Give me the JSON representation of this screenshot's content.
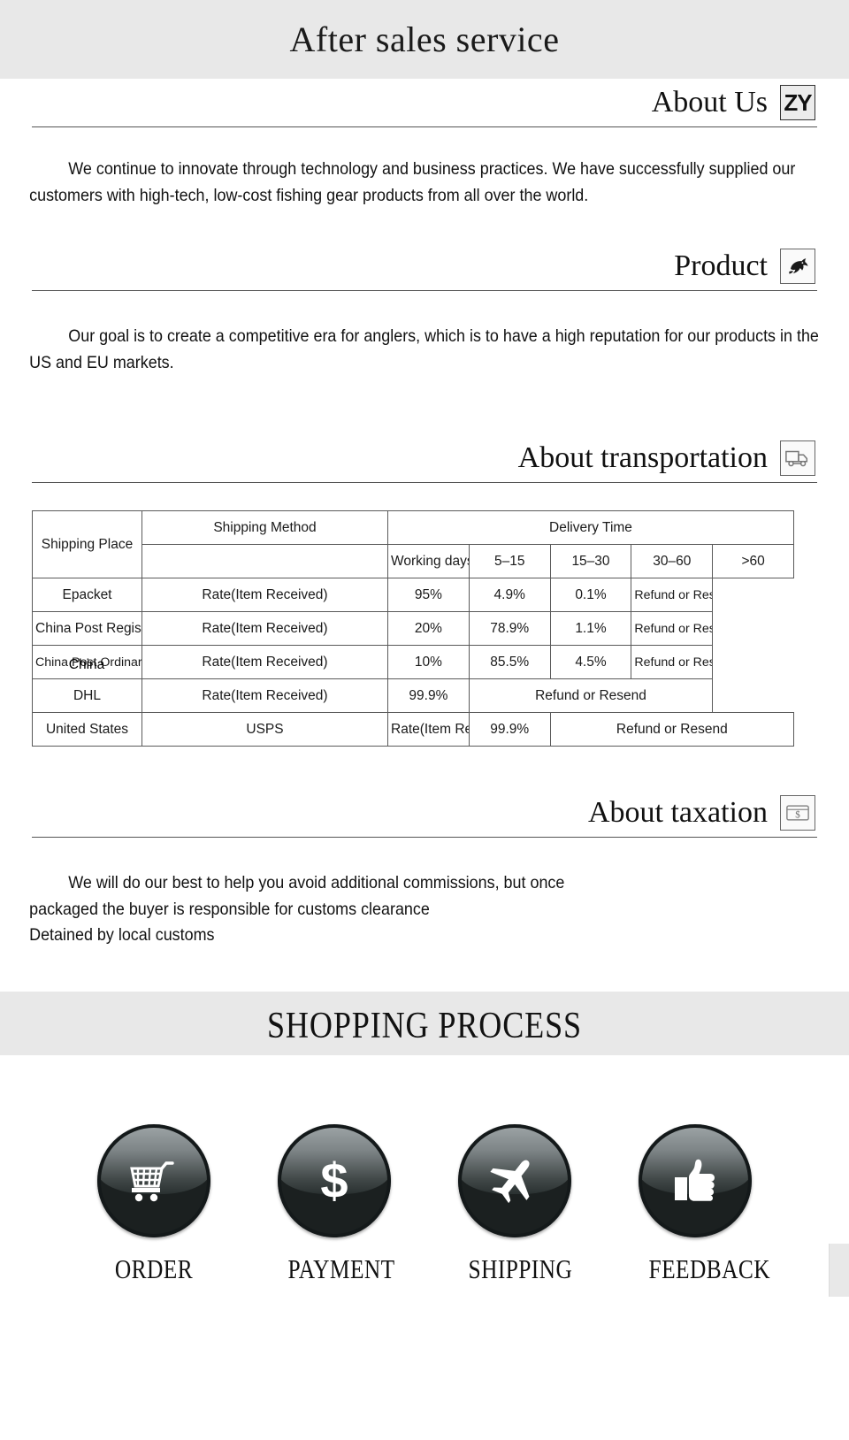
{
  "header": {
    "title": "After sales service"
  },
  "sections": [
    {
      "id": "about-us",
      "title": "About Us",
      "icon": "zy-logo-icon",
      "icon_text": "ZY",
      "paragraph": "We continue to innovate through technology and business practices. We have successfully supplied our customers with high-tech, low-cost fishing gear products from all over the world."
    },
    {
      "id": "product",
      "title": "Product",
      "icon": "fish-icon",
      "paragraph": "Our goal is to create a competitive era for anglers, which is to have a high reputation for our products in the US and EU markets."
    },
    {
      "id": "about-transportation",
      "title": "About transportation",
      "icon": "delivery-truck-icon"
    },
    {
      "id": "about-taxation",
      "title": "About taxation",
      "icon": "money-bill-icon",
      "lines": [
        "We will do our best to help you avoid additional commissions, but once",
        "packaged the buyer is responsible for customs clearance",
        "Detained by local customs"
      ]
    }
  ],
  "shipping_table": {
    "headers": {
      "shipping_place": "Shipping Place",
      "shipping_method": "Shipping Method",
      "delivery_time": "Delivery Time"
    },
    "subheaders": {
      "working_days": "Working days",
      "d1": "5–15",
      "d2": "15–30",
      "d3": "30–60",
      "d4": ">60"
    },
    "rows": [
      {
        "place": "China",
        "method": "Epacket",
        "rate_label": "Rate(Item Received)",
        "d1": "95%",
        "d2": "4.9%",
        "d3": "0.1%",
        "d4": "Refund or Resend",
        "merged": false
      },
      {
        "place": "",
        "method": "China Post Registered Air Mail",
        "rate_label": "Rate(Item Received)",
        "d1": "20%",
        "d2": "78.9%",
        "d3": "1.1%",
        "d4": "Refund or Resend",
        "merged": false
      },
      {
        "place": "",
        "method": "China Post Ordinary Small Packet Plus",
        "rate_label": "Rate(Item Received)",
        "d1": "10%",
        "d2": "85.5%",
        "d3": "4.5%",
        "d4": "Refund or Resend",
        "merged": false
      },
      {
        "place": "",
        "method": "DHL",
        "rate_label": "Rate(Item Received)",
        "d1": "99.9%",
        "merged_label": "Refund or Resend",
        "merged": true
      },
      {
        "place": "United States",
        "method": "USPS",
        "rate_label": "Rate(Item Received)",
        "d1": "99.9%",
        "merged_label": "Refund or Resend",
        "merged": true
      }
    ]
  },
  "shopping_process": {
    "banner_title": "SHOPPING PROCESS",
    "steps": [
      {
        "label": "ORDER",
        "icon": "shopping-cart-icon"
      },
      {
        "label": "PAYMENT",
        "icon": "dollar-sign-icon"
      },
      {
        "label": "SHIPPING",
        "icon": "airplane-icon"
      },
      {
        "label": "FEEDBACK",
        "icon": "thumbs-up-icon"
      }
    ]
  },
  "colors": {
    "banner_bg": "#e8e8e8",
    "text": "#111111",
    "table_border": "#5a5a5a",
    "icon_dark": "#1b2020"
  }
}
